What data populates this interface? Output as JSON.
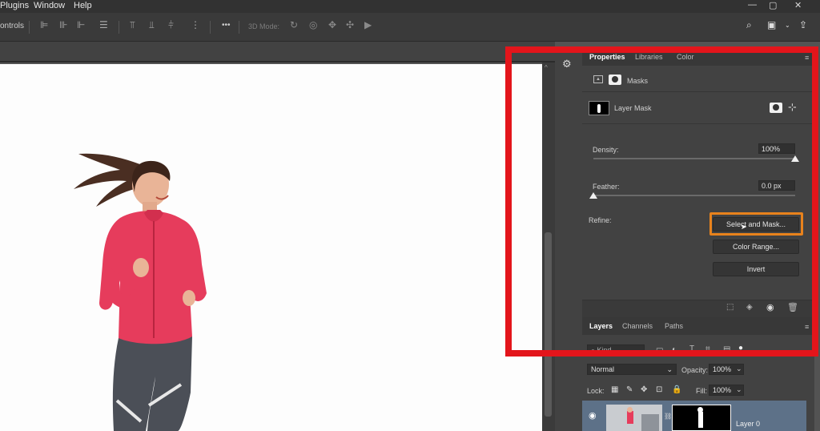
{
  "menu": {
    "items": [
      "Plugins",
      "Window",
      "Help"
    ]
  },
  "options_bar": {
    "controls_label": "ontrols",
    "mode_3d_label": "3D Mode:",
    "more_label": "•••"
  },
  "properties": {
    "tabs": [
      "Properties",
      "Libraries",
      "Color"
    ],
    "masks_label": "Masks",
    "layer_mask_label": "Layer Mask",
    "density_label": "Density:",
    "density_value": "100%",
    "density_fraction": 1.0,
    "feather_label": "Feather:",
    "feather_value": "0.0 px",
    "feather_fraction": 0.0,
    "refine_label": "Refine:",
    "buttons": {
      "select_and_mask": "Select and Mask...",
      "color_range": "Color Range...",
      "invert": "Invert"
    }
  },
  "layers": {
    "tabs": [
      "Layers",
      "Channels",
      "Paths"
    ],
    "kind_placeholder": "Kind",
    "blend_mode": "Normal",
    "opacity_label": "Opacity:",
    "opacity_value": "100%",
    "lock_label": "Lock:",
    "fill_label": "Fill:",
    "fill_value": "100%",
    "layer_name": "Layer 0"
  },
  "colors": {
    "annotation_red": "#e3151b",
    "annotation_orange": "#e8821c",
    "panel": "#424242"
  }
}
